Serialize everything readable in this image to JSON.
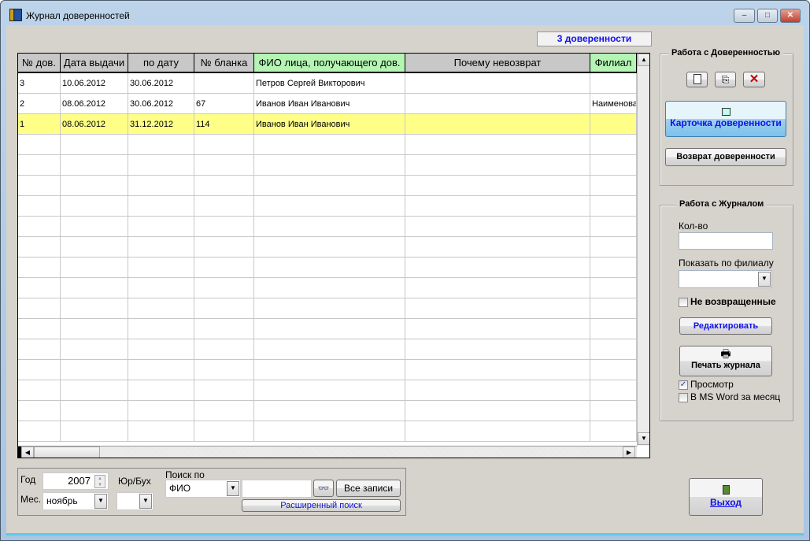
{
  "window": {
    "title": "Журнал доверенностей",
    "minimize": "–",
    "maximize": "□",
    "close": "✕"
  },
  "counter": "3 доверенности",
  "grid": {
    "columns": [
      "№ дов.",
      "Дата выдачи",
      "по дату",
      "№ бланка",
      "ФИО лица, получающего дов.",
      "Почему невозврат",
      "Филиал"
    ],
    "rows": [
      [
        "3",
        "10.06.2012",
        "30.06.2012",
        "",
        "Петров Сергей Викторович",
        "",
        ""
      ],
      [
        "2",
        "08.06.2012",
        "30.06.2012",
        "67",
        "Иванов Иван Иванович",
        "",
        "Наименова"
      ],
      [
        "1",
        "08.06.2012",
        "31.12.2012",
        "114",
        "Иванов Иван Иванович",
        "",
        ""
      ]
    ],
    "selected_row": 2,
    "selected_color": "#ffff88"
  },
  "proxy_group": {
    "title": "Работа с Доверенностью",
    "card_button": "Карточка доверенности",
    "return_button": "Возврат доверенности"
  },
  "journal_group": {
    "title": "Работа с Журналом",
    "qty_label": "Кол-во",
    "qty_value": "",
    "branch_label": "Показать по филиалу",
    "branch_value": "",
    "not_returned_label": "Не возвращенные",
    "edit_button": "Редактировать",
    "print_button": "Печать журнала",
    "preview_label": "Просмотр",
    "preview_checked": true,
    "word_label": "В MS Word за месяц"
  },
  "filter": {
    "year_label": "Год",
    "year_value": "2007",
    "month_label": "Мес.",
    "month_value": "ноябрь",
    "type_label": "Юр/Бух",
    "type_value": "",
    "search_label": "Поиск по",
    "search_field": "ФИО",
    "search_value": "",
    "all_records_button": "Все записи",
    "advanced_search_button": "Расширенный поиск"
  },
  "exit_button": "Выход"
}
